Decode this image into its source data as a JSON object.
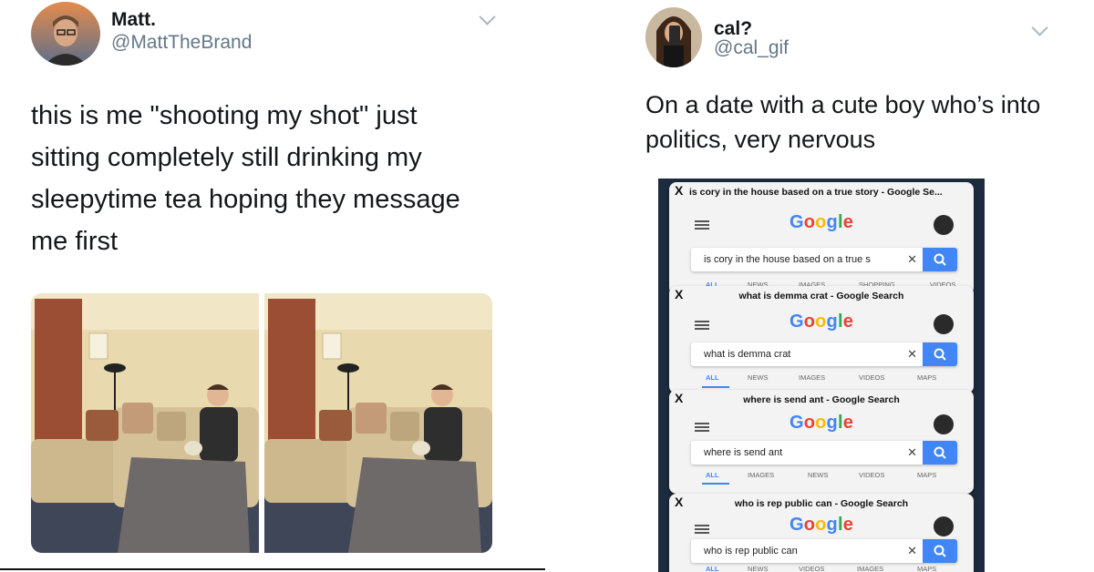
{
  "left_tweet": {
    "name": "Matt.",
    "handle": "@MattTheBrand",
    "text_lines": [
      "this is me \"shooting my shot\" just",
      "sitting completely still drinking my",
      "sleepytime tea hoping they message",
      "me first"
    ]
  },
  "right_tweet": {
    "name": "cal?",
    "handle": "@cal_gif",
    "text_lines": [
      "On a date with a cute boy who’s into",
      "politics, very nervous"
    ]
  },
  "search_cards": [
    {
      "title": "is cory in the house based on a true story - Google Se...",
      "query": "is cory in the house based on a true s",
      "tabs": [
        "ALL",
        "NEWS",
        "IMAGES",
        "SHOPPING",
        "VIDEOS"
      ]
    },
    {
      "title": "what is demma crat - Google Search",
      "query": "what is demma crat",
      "tabs": [
        "ALL",
        "NEWS",
        "IMAGES",
        "VIDEOS",
        "MAPS"
      ]
    },
    {
      "title": "where is send ant - Google Search",
      "query": "where is send ant",
      "tabs": [
        "ALL",
        "IMAGES",
        "NEWS",
        "VIDEOS",
        "MAPS"
      ]
    },
    {
      "title": "who is rep public can - Google Search",
      "query": "who is rep public can",
      "tabs": [
        "ALL",
        "NEWS",
        "VIDEOS",
        "IMAGES",
        "MAPS"
      ]
    }
  ],
  "google_logo": {
    "G": "G",
    "o1": "o",
    "o2": "o",
    "g": "g",
    "l": "l",
    "e": "e"
  },
  "glyphs": {
    "close": "✕",
    "clear": "✕",
    "tab_x": "X"
  },
  "colors": {
    "link_blue": "#4285f4",
    "handle_gray": "#657786",
    "phone_bg": "#1d2b3f"
  }
}
